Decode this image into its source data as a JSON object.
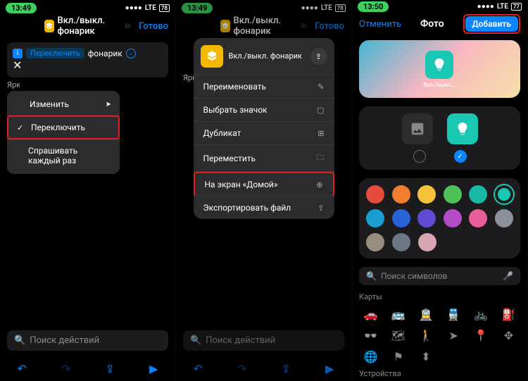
{
  "screens": {
    "1": {
      "status": {
        "time": "13:49",
        "net": "LTE",
        "battery": "78"
      },
      "header": {
        "back": "",
        "title": "Вкл./выкл. фонарик",
        "done": "Готово"
      },
      "action": {
        "info_icon": "i",
        "param": "Переключить",
        "object": "фонарик"
      },
      "brightness_label": "Яркость",
      "dropdown": {
        "edit": "Изменить",
        "toggle": "Переключить",
        "ask": "Спрашивать каждый раз"
      },
      "search_placeholder": "Поиск действий"
    },
    "2": {
      "status": {
        "time": "13:49",
        "net": "LTE",
        "battery": "78"
      },
      "header": {
        "back": "",
        "title": "Вкл./выкл. фонарик",
        "done": "Готово"
      },
      "brightness_label": "Яркость",
      "sheet": {
        "name": "Вкл./выкл. фонарик",
        "rename": "Переименовать",
        "choose_icon": "Выбрать значок",
        "duplicate": "Дубликат",
        "move": "Переместить",
        "home": "На экран «Домой»",
        "export": "Экспортировать файл"
      },
      "search_placeholder": "Поиск действий"
    },
    "3": {
      "status": {
        "time": "13:50",
        "net": "LTE",
        "battery": "77"
      },
      "header": {
        "cancel": "Отменить",
        "title": "Фото",
        "add": "Добавить"
      },
      "preview_label": "Вкл./выкл.…",
      "symbol_search": "Поиск символов",
      "section_maps": "Карты",
      "section_devices": "Устройства",
      "colors": {
        "row1": [
          "#e64c3c",
          "#f0802f",
          "#f4c33a",
          "#4fc15a",
          "#18b8a4",
          "#17c9b2"
        ],
        "row2": [
          "#1a9ecf",
          "#2762d9",
          "#5f4bd1",
          "#b24dc7",
          "#e85c97",
          "#8c9199"
        ],
        "row3": [
          "#9a8d7d",
          "#6b7785",
          "#d9a5b3"
        ]
      }
    }
  }
}
